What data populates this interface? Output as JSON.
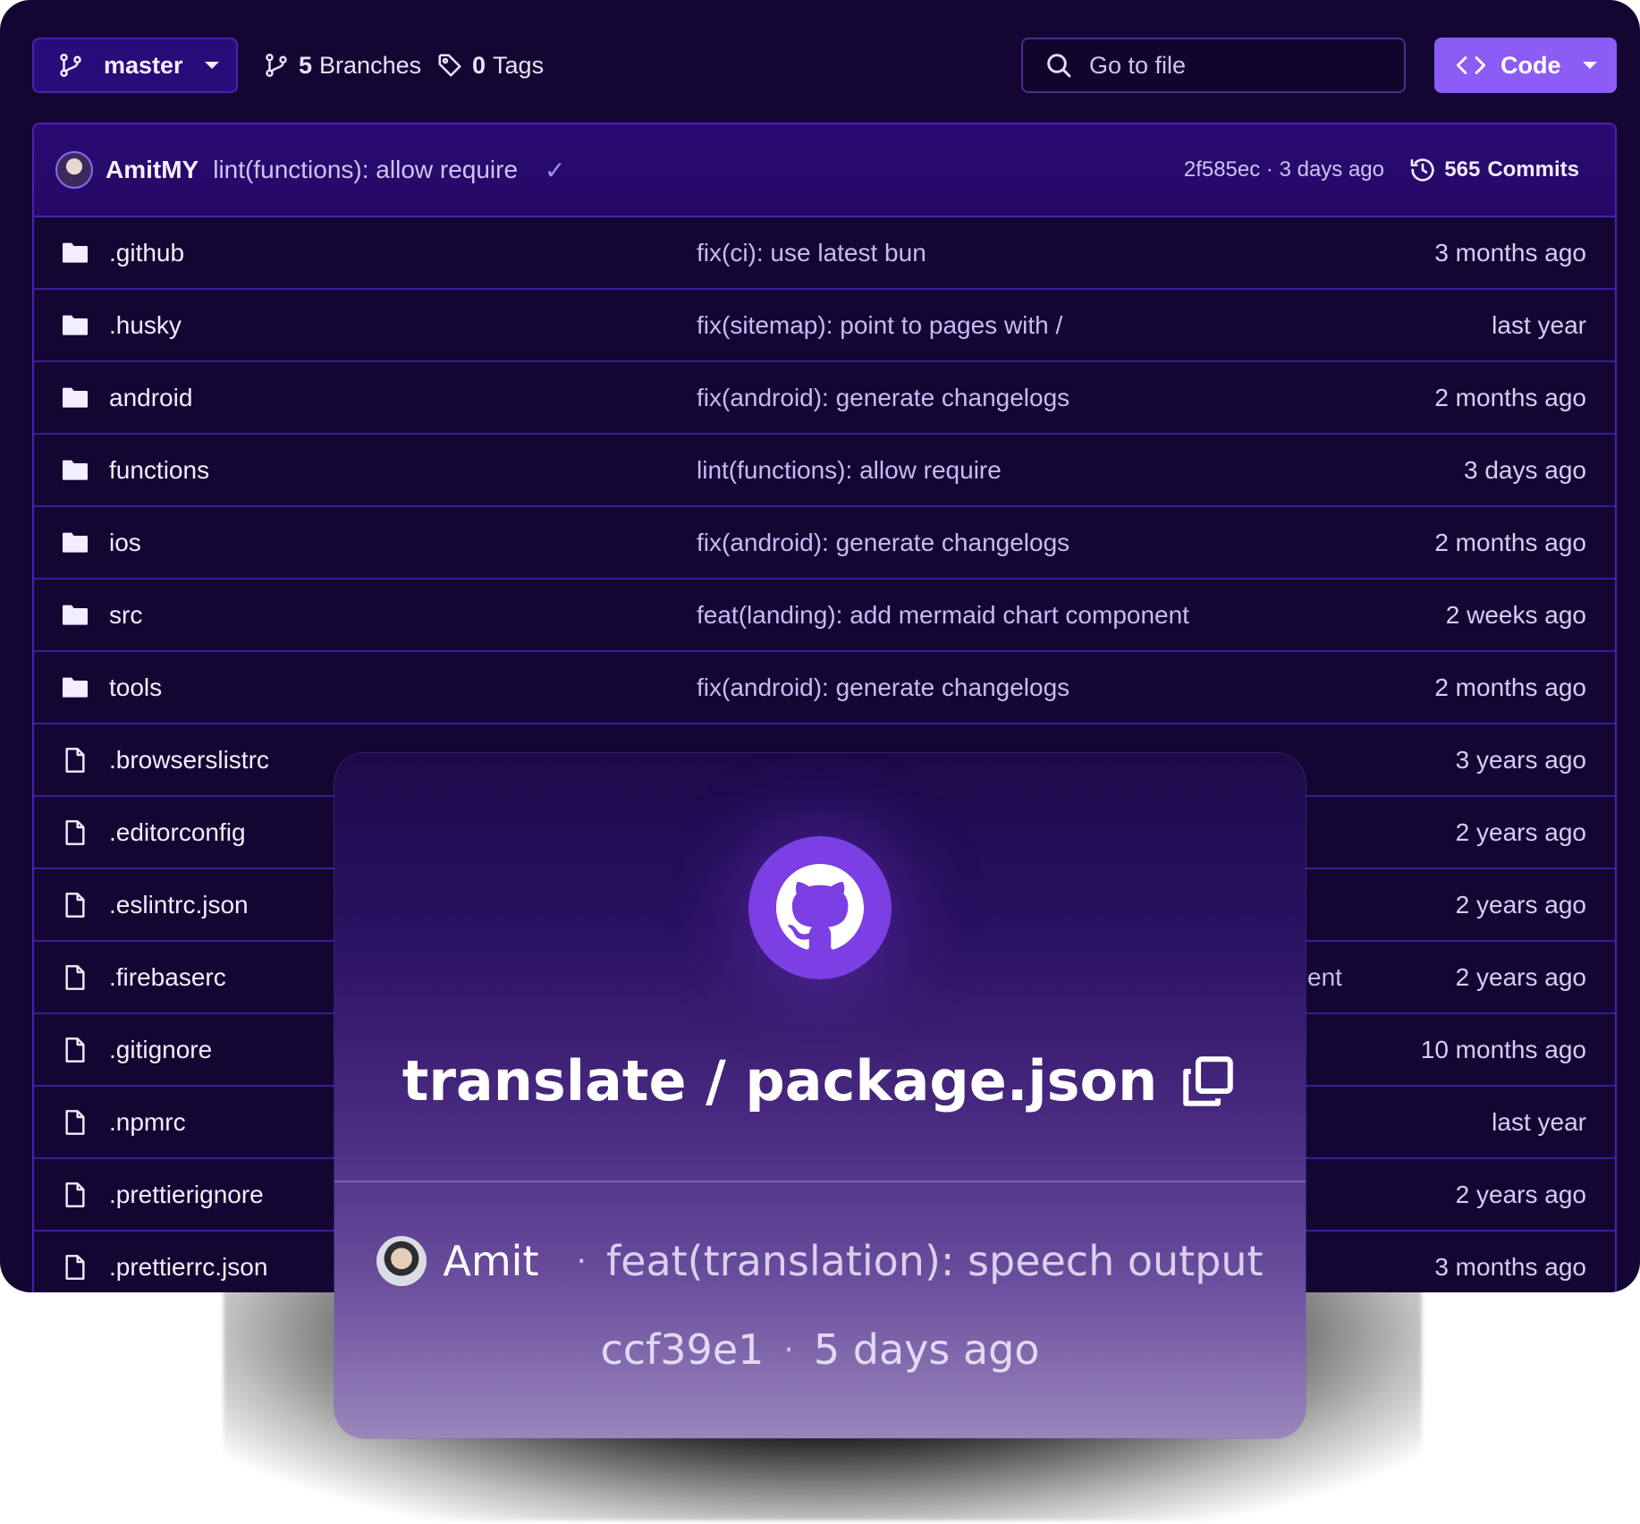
{
  "toolbar": {
    "branch": "master",
    "branches_count": "5",
    "branches_label": "Branches",
    "tags_count": "0",
    "tags_label": "Tags",
    "search_placeholder": "Go to file",
    "code_label": "Code"
  },
  "latest_commit": {
    "author": "AmitMY",
    "message": "lint(functions): allow require",
    "meta": "2f585ec · 3 days ago",
    "commits_count": "565",
    "commits_label": "Commits"
  },
  "files": [
    {
      "name": ".github",
      "type": "folder",
      "message": "fix(ci): use latest bun",
      "time": "3 months ago"
    },
    {
      "name": ".husky",
      "type": "folder",
      "message": "fix(sitemap): point to pages with /",
      "time": "last year"
    },
    {
      "name": "android",
      "type": "folder",
      "message": "fix(android): generate changelogs",
      "time": "2 months ago"
    },
    {
      "name": "functions",
      "type": "folder",
      "message": "lint(functions): allow require",
      "time": "3 days ago"
    },
    {
      "name": "ios",
      "type": "folder",
      "message": "fix(android): generate changelogs",
      "time": "2 months ago"
    },
    {
      "name": "src",
      "type": "folder",
      "message": "feat(landing): add mermaid chart component",
      "time": "2 weeks ago"
    },
    {
      "name": "tools",
      "type": "folder",
      "message": "fix(android): generate changelogs",
      "time": "2 months ago"
    },
    {
      "name": ".browserslistrc",
      "type": "file",
      "message": "",
      "time": "3 years ago"
    },
    {
      "name": ".editorconfig",
      "type": "file",
      "message": "",
      "time": "2 years ago"
    },
    {
      "name": ".eslintrc.json",
      "type": "file",
      "message": "",
      "time": "2 years ago"
    },
    {
      "name": ".firebaserc",
      "type": "file",
      "message": "ent",
      "time": "2 years ago"
    },
    {
      "name": ".gitignore",
      "type": "file",
      "message": "",
      "time": "10 months ago"
    },
    {
      "name": ".npmrc",
      "type": "file",
      "message": "",
      "time": "last year"
    },
    {
      "name": ".prettierignore",
      "type": "file",
      "message": "",
      "time": "2 years ago"
    },
    {
      "name": ".prettierrc.json",
      "type": "file",
      "message": "",
      "time": "3 months ago"
    }
  ],
  "popup": {
    "title": "translate / package.json",
    "author": "Amit",
    "message": "feat(translation): speech output",
    "sha": "ccf39e1",
    "time": "5 days ago"
  },
  "colors": {
    "background": "#130633",
    "accent": "#8b5cf6",
    "border": "#4a22b0",
    "logo": "#7b3fe4"
  },
  "icons": [
    "branch-icon",
    "tag-icon",
    "search-icon",
    "code-icon",
    "history-icon",
    "folder-icon",
    "file-icon",
    "github-icon",
    "copy-icon",
    "check-icon"
  ]
}
